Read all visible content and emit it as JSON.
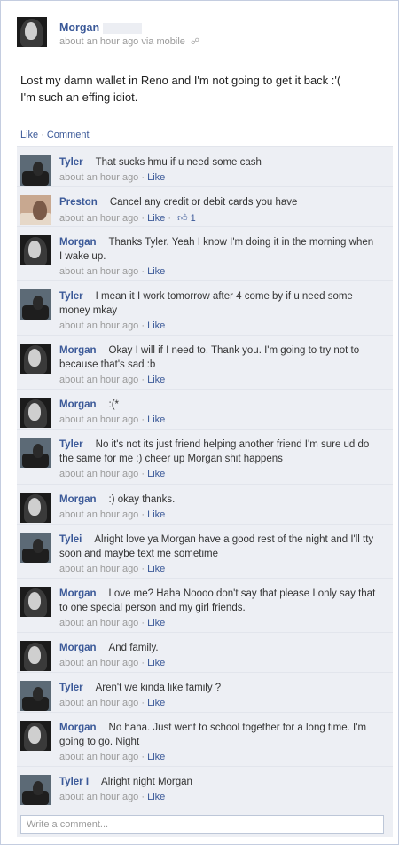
{
  "post": {
    "author": "Morgan",
    "meta": "about an hour ago via mobile",
    "text_line1": "Lost my damn wallet in Reno and I'm not going to get it back :'(",
    "text_line2": "I'm such an effing idiot."
  },
  "actions": {
    "like": "Like",
    "comment": "Comment",
    "separator": "·"
  },
  "comments": [
    {
      "name": "Tyler",
      "text": "That sucks hmu if u need some cash",
      "time": "about an hour ago",
      "like": "Like",
      "avatar": "tyler-avatar"
    },
    {
      "name": "Preston",
      "text": "Cancel any credit or debit cards you have",
      "time": "about an hour ago",
      "like": "Like",
      "likes_count": "1",
      "avatar": "preston-avatar"
    },
    {
      "name": "Morgan",
      "text": "Thanks Tyler. Yeah I know I'm doing it in the morning when I wake up.",
      "time": "about an hour ago",
      "like": "Like",
      "avatar": "morgan-avatar"
    },
    {
      "name": "Tyler",
      "text": "I mean it I work tomorrow after 4 come by if u need some money mkay",
      "time": "about an hour ago",
      "like": "Like",
      "avatar": "tyler-avatar"
    },
    {
      "name": "Morgan",
      "text": "Okay I will if I need to. Thank you. I'm going to try not to because that's sad :b",
      "time": "about an hour ago",
      "like": "Like",
      "avatar": "morgan-avatar"
    },
    {
      "name": "Morgan",
      "text": ":(*",
      "time": "about an hour ago",
      "like": "Like",
      "avatar": "morgan-avatar"
    },
    {
      "name": "Tyler",
      "text": "No it's not its just friend helping another friend I'm sure ud do the same for me :) cheer up Morgan shit happens",
      "time": "about an hour ago",
      "like": "Like",
      "avatar": "tyler-avatar"
    },
    {
      "name": "Morgan",
      "text": ":) okay thanks.",
      "time": "about an hour ago",
      "like": "Like",
      "avatar": "morgan-avatar"
    },
    {
      "name": "Tylei",
      "text": "Alright love ya Morgan have a good rest of the night and I'll tty soon and maybe text me sometime",
      "time": "about an hour ago",
      "like": "Like",
      "avatar": "tyler-avatar"
    },
    {
      "name": "Morgan",
      "text": "Love me? Haha Noooo don't say that please I only say that to one special person and my girl friends.",
      "time": "about an hour ago",
      "like": "Like",
      "avatar": "morgan-avatar"
    },
    {
      "name": "Morgan",
      "text": "And family.",
      "time": "about an hour ago",
      "like": "Like",
      "avatar": "morgan-avatar"
    },
    {
      "name": "Tyler",
      "text": "Aren't we kinda like family ?",
      "time": "about an hour ago",
      "like": "Like",
      "avatar": "tyler-avatar"
    },
    {
      "name": "Morgan",
      "text": "No haha. Just went to school together for a long time. I'm going to go. Night",
      "time": "about an hour ago",
      "like": "Like",
      "avatar": "morgan-avatar"
    },
    {
      "name": "Tyler I",
      "text": "Alright night Morgan",
      "time": "about an hour ago",
      "like": "Like",
      "avatar": "tyler-avatar"
    }
  ],
  "comment_box": {
    "placeholder": "Write a comment..."
  },
  "colors": {
    "link": "#3b5998",
    "meta": "#999999",
    "comment_bg": "#edeff4"
  }
}
